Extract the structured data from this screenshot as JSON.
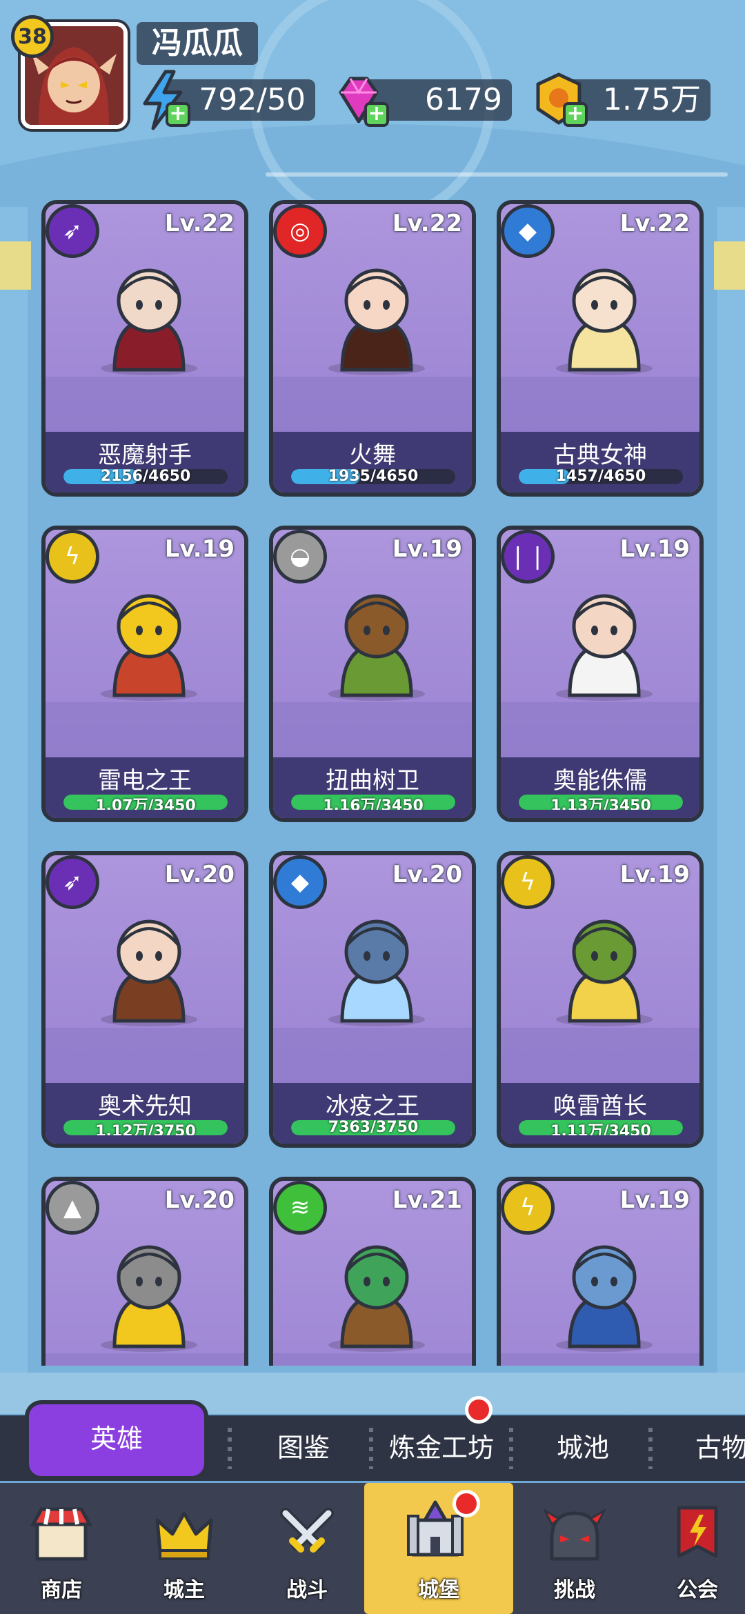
{
  "player": {
    "level": "38",
    "name": "冯瓜瓜"
  },
  "resources": {
    "energy": "792/50",
    "gems": "6179",
    "gold": "1.75万"
  },
  "heroes": [
    {
      "name": "恶魔射手",
      "level": "Lv.22",
      "progress_text": "2156/4650",
      "progress": 0.46,
      "bar_color": "#3fb0e8",
      "class_icon": "archer-icon",
      "class_color": "#6b2fb5"
    },
    {
      "name": "火舞",
      "level": "Lv.22",
      "progress_text": "1935/4650",
      "progress": 0.42,
      "bar_color": "#3fb0e8",
      "class_icon": "fire-ring-icon",
      "class_color": "#e02626"
    },
    {
      "name": "古典女神",
      "level": "Lv.22",
      "progress_text": "1457/4650",
      "progress": 0.31,
      "bar_color": "#3fb0e8",
      "class_icon": "crystal-icon",
      "class_color": "#2f7bd6"
    },
    {
      "name": "雷电之王",
      "level": "Lv.19",
      "progress_text": "1.07万/3450",
      "progress": 1.0,
      "bar_color": "#34c35c",
      "class_icon": "lightning-icon",
      "class_color": "#e8c21a"
    },
    {
      "name": "扭曲树卫",
      "level": "Lv.19",
      "progress_text": "1.16万/3450",
      "progress": 1.0,
      "bar_color": "#34c35c",
      "class_icon": "shield-icon",
      "class_color": "#9a9a9a"
    },
    {
      "name": "奥能侏儒",
      "level": "Lv.19",
      "progress_text": "1.13万/3450",
      "progress": 1.0,
      "bar_color": "#34c35c",
      "class_icon": "arcane-icon",
      "class_color": "#6b2fb5"
    },
    {
      "name": "奥术先知",
      "level": "Lv.20",
      "progress_text": "1.12万/3750",
      "progress": 1.0,
      "bar_color": "#34c35c",
      "class_icon": "archer-icon",
      "class_color": "#6b2fb5"
    },
    {
      "name": "冰疫之王",
      "level": "Lv.20",
      "progress_text": "7363/3750",
      "progress": 1.0,
      "bar_color": "#34c35c",
      "class_icon": "crystal-icon",
      "class_color": "#2f7bd6"
    },
    {
      "name": "唤雷酋长",
      "level": "Lv.19",
      "progress_text": "1.11万/3450",
      "progress": 1.0,
      "bar_color": "#34c35c",
      "class_icon": "lightning-icon",
      "class_color": "#e8c21a"
    },
    {
      "name": "",
      "level": "Lv.20",
      "progress_text": "",
      "progress": 0,
      "bar_color": "#34c35c",
      "class_icon": "rock-icon",
      "class_color": "#9a9a9a"
    },
    {
      "name": "",
      "level": "Lv.21",
      "progress_text": "",
      "progress": 0,
      "bar_color": "#34c35c",
      "class_icon": "tornado-icon",
      "class_color": "#3fbf3a"
    },
    {
      "name": "",
      "level": "Lv.19",
      "progress_text": "",
      "progress": 0,
      "bar_color": "#34c35c",
      "class_icon": "lightning-icon",
      "class_color": "#e8c21a"
    }
  ],
  "sub_tabs": {
    "heroes": "英雄",
    "codex": "图鉴",
    "alchemy": "炼金工坊",
    "city": "城池",
    "relics": "古物"
  },
  "nav": {
    "shop": "商店",
    "lord": "城主",
    "battle": "战斗",
    "castle": "城堡",
    "challenge": "挑战",
    "guild": "公会"
  }
}
